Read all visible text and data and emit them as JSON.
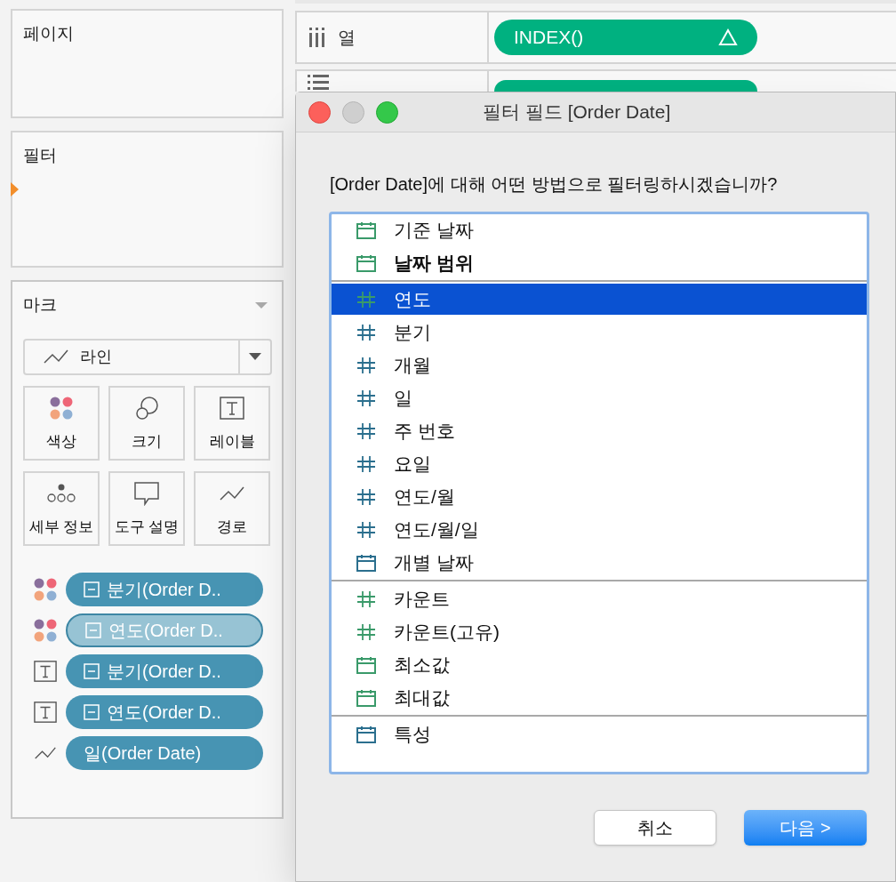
{
  "pages_card": {
    "title": "페이지"
  },
  "filters_card": {
    "title": "필터"
  },
  "marks_card": {
    "title": "마크",
    "mark_type": "라인",
    "buttons": [
      {
        "kind": "color",
        "label": "색상"
      },
      {
        "kind": "size",
        "label": "크기"
      },
      {
        "kind": "label",
        "label": "레이블"
      },
      {
        "kind": "detail",
        "label": "세부 정보"
      },
      {
        "kind": "tooltip",
        "label": "도구 설명"
      },
      {
        "kind": "path",
        "label": "경로"
      }
    ],
    "pills": [
      {
        "kind": "color",
        "label": "분기(Order D..",
        "expandable": true,
        "selected": false
      },
      {
        "kind": "color",
        "label": "연도(Order D..",
        "expandable": true,
        "selected": true
      },
      {
        "kind": "label",
        "label": "분기(Order D..",
        "expandable": true,
        "selected": false
      },
      {
        "kind": "label",
        "label": "연도(Order D..",
        "expandable": true,
        "selected": false
      },
      {
        "kind": "path",
        "label": "일(Order Date)",
        "expandable": false,
        "selected": false
      }
    ]
  },
  "shelves": [
    {
      "kind": "columns",
      "label": "열",
      "pill": "INDEX()"
    },
    {
      "kind": "rows"
    }
  ],
  "dialog": {
    "title": "필터 필드 [Order Date]",
    "question": "[Order Date]에 대해 어떤 방법으로 필터링하시겠습니까?",
    "groups": [
      [
        {
          "kind": "date",
          "color": "#3a9a6a",
          "label": "기준 날짜",
          "bold": false,
          "selected": false
        },
        {
          "kind": "date",
          "color": "#3a9a6a",
          "label": "날짜 범위",
          "bold": true,
          "selected": false
        }
      ],
      [
        {
          "kind": "number",
          "color": "#3a9a6a",
          "label": "연도",
          "bold": false,
          "selected": true
        },
        {
          "kind": "number",
          "color": "#2b6f8e",
          "label": "분기",
          "bold": false,
          "selected": false
        },
        {
          "kind": "number",
          "color": "#2b6f8e",
          "label": "개월",
          "bold": false,
          "selected": false
        },
        {
          "kind": "number",
          "color": "#2b6f8e",
          "label": "일",
          "bold": false,
          "selected": false
        },
        {
          "kind": "number",
          "color": "#2b6f8e",
          "label": "주 번호",
          "bold": false,
          "selected": false
        },
        {
          "kind": "number",
          "color": "#2b6f8e",
          "label": "요일",
          "bold": false,
          "selected": false
        },
        {
          "kind": "number",
          "color": "#2b6f8e",
          "label": "연도/월",
          "bold": false,
          "selected": false
        },
        {
          "kind": "number",
          "color": "#2b6f8e",
          "label": "연도/월/일",
          "bold": false,
          "selected": false
        },
        {
          "kind": "date",
          "color": "#2b6f8e",
          "label": "개별 날짜",
          "bold": false,
          "selected": false
        }
      ],
      [
        {
          "kind": "number",
          "color": "#3a9a6a",
          "label": "카운트",
          "bold": false,
          "selected": false
        },
        {
          "kind": "number",
          "color": "#3a9a6a",
          "label": "카운트(고유)",
          "bold": false,
          "selected": false
        },
        {
          "kind": "date",
          "color": "#3a9a6a",
          "label": "최소값",
          "bold": false,
          "selected": false
        },
        {
          "kind": "date",
          "color": "#3a9a6a",
          "label": "최대값",
          "bold": false,
          "selected": false
        }
      ],
      [
        {
          "kind": "date",
          "color": "#2b6f8e",
          "label": "특성",
          "bold": false,
          "selected": false
        }
      ]
    ],
    "cancel": "취소",
    "next": "다음 >"
  }
}
